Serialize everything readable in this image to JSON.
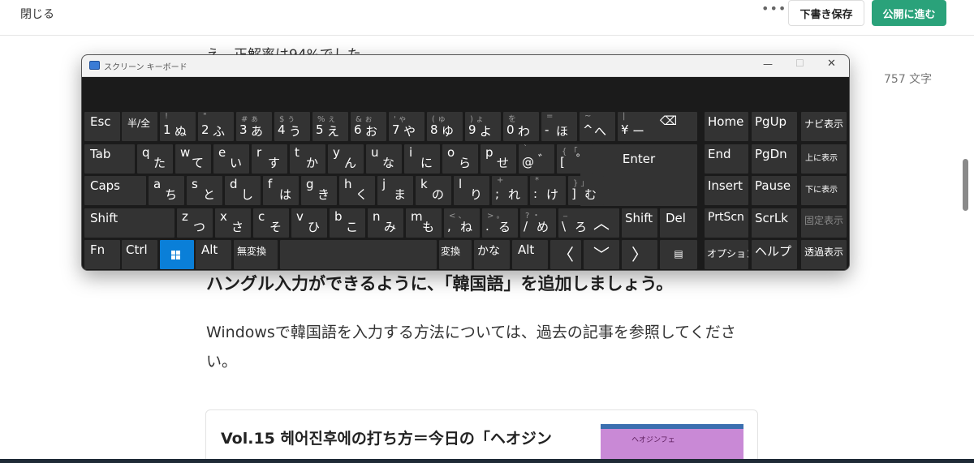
{
  "header": {
    "close_label": "閉じる",
    "more_label": "•••",
    "save_draft_label": "下書き保存",
    "publish_label": "公開に進む"
  },
  "editor": {
    "partial_line": "え、正解率は94%でした",
    "char_count": "757 文字",
    "heading": "ハングル入力ができるように、「韓国語」を追加しましょう。",
    "paragraph": "Windowsで韓国語を入力する方法については、過去の記事を参照してください。",
    "card_title": "Vol.15 헤어진후에の打ち方＝今日の「ヘオジン",
    "card_thumb_text": "ヘオジンフェ"
  },
  "osk": {
    "title": "スクリーン キーボード",
    "controls": {
      "minimize": "—",
      "maximize": "☐",
      "close": "✕"
    },
    "number_row": [
      {
        "shift": "!",
        "base": "1",
        "kana": "ぬ"
      },
      {
        "shift": "\"",
        "base": "2",
        "kana": "ふ"
      },
      {
        "shift": "# ぁ",
        "base": "3",
        "kana": "あ"
      },
      {
        "shift": "$ ぅ",
        "base": "4",
        "kana": "う"
      },
      {
        "shift": "% ぇ",
        "base": "5",
        "kana": "え"
      },
      {
        "shift": "& ぉ",
        "base": "6",
        "kana": "お"
      },
      {
        "shift": "' ゃ",
        "base": "7",
        "kana": "や"
      },
      {
        "shift": "( ゅ",
        "base": "8",
        "kana": "ゆ"
      },
      {
        "shift": ") ょ",
        "base": "9",
        "kana": "よ"
      },
      {
        "shift": "を",
        "base": "0",
        "kana": "わ"
      },
      {
        "shift": "=",
        "base": "-",
        "kana": "ほ"
      },
      {
        "shift": "~",
        "base": "^",
        "kana": "へ"
      },
      {
        "shift": "|",
        "base": "¥",
        "kana": "ー"
      }
    ],
    "q_row": [
      {
        "letter": "q",
        "kana": "た"
      },
      {
        "letter": "w",
        "kana": "て"
      },
      {
        "letter": "e",
        "kana": "い"
      },
      {
        "letter": "r",
        "kana": "す"
      },
      {
        "letter": "t",
        "kana": "か"
      },
      {
        "letter": "y",
        "kana": "ん"
      },
      {
        "letter": "u",
        "kana": "な"
      },
      {
        "letter": "i",
        "kana": "に"
      },
      {
        "letter": "o",
        "kana": "ら"
      },
      {
        "letter": "p",
        "kana": "せ"
      }
    ],
    "q_row_extra": [
      {
        "shift": "`",
        "base": "@",
        "kana": "゛"
      },
      {
        "shift": "{ 「",
        "base": "[",
        "kana": "゜"
      }
    ],
    "a_row": [
      {
        "letter": "a",
        "kana": "ち"
      },
      {
        "letter": "s",
        "kana": "と"
      },
      {
        "letter": "d",
        "kana": "し"
      },
      {
        "letter": "f",
        "kana": "は"
      },
      {
        "letter": "g",
        "kana": "き"
      },
      {
        "letter": "h",
        "kana": "く"
      },
      {
        "letter": "j",
        "kana": "ま"
      },
      {
        "letter": "k",
        "kana": "の"
      },
      {
        "letter": "l",
        "kana": "り"
      }
    ],
    "a_row_extra": [
      {
        "shift": "+",
        "base": ";",
        "kana": "れ"
      },
      {
        "shift": "*",
        "base": ":",
        "kana": "け"
      },
      {
        "shift": "} 」",
        "base": "]",
        "kana": "む"
      }
    ],
    "z_row": [
      {
        "letter": "z",
        "kana": "つ"
      },
      {
        "letter": "x",
        "kana": "さ"
      },
      {
        "letter": "c",
        "kana": "そ"
      },
      {
        "letter": "v",
        "kana": "ひ"
      },
      {
        "letter": "b",
        "kana": "こ"
      },
      {
        "letter": "n",
        "kana": "み"
      },
      {
        "letter": "m",
        "kana": "も"
      }
    ],
    "z_row_extra": [
      {
        "shift": "< 、",
        "base": ",",
        "kana": "ね"
      },
      {
        "shift": "> 。",
        "base": ".",
        "kana": "る"
      },
      {
        "shift": "? ・",
        "base": "/",
        "kana": "め"
      },
      {
        "shift": "_",
        "base": "\\",
        "kana": "ろ"
      }
    ],
    "keys": {
      "esc": "Esc",
      "hankaku": "半/全",
      "backspace": "⌫",
      "tab": "Tab",
      "enter": "Enter",
      "caps": "Caps",
      "shift": "Shift",
      "shift_right": "Shift",
      "del": "Del",
      "fn": "Fn",
      "ctrl": "Ctrl",
      "alt": "Alt",
      "alt_right": "Alt",
      "muhenkan": "無変換",
      "henkan": "変換",
      "kana": "かな",
      "up": "︿",
      "down": "﹀",
      "left": "〈",
      "right": "〉",
      "menu": "▤",
      "home": "Home",
      "pgup": "PgUp",
      "nav": "ナビ表示",
      "end": "End",
      "pgdn": "PgDn",
      "move_up": "上に表示",
      "insert": "Insert",
      "pause": "Pause",
      "move_down": "下に表示",
      "prtscn": "PrtScn",
      "scrlk": "ScrLk",
      "dock": "固定表示",
      "options": "オプション",
      "help": "ヘルプ",
      "fade": "透過表示"
    }
  }
}
